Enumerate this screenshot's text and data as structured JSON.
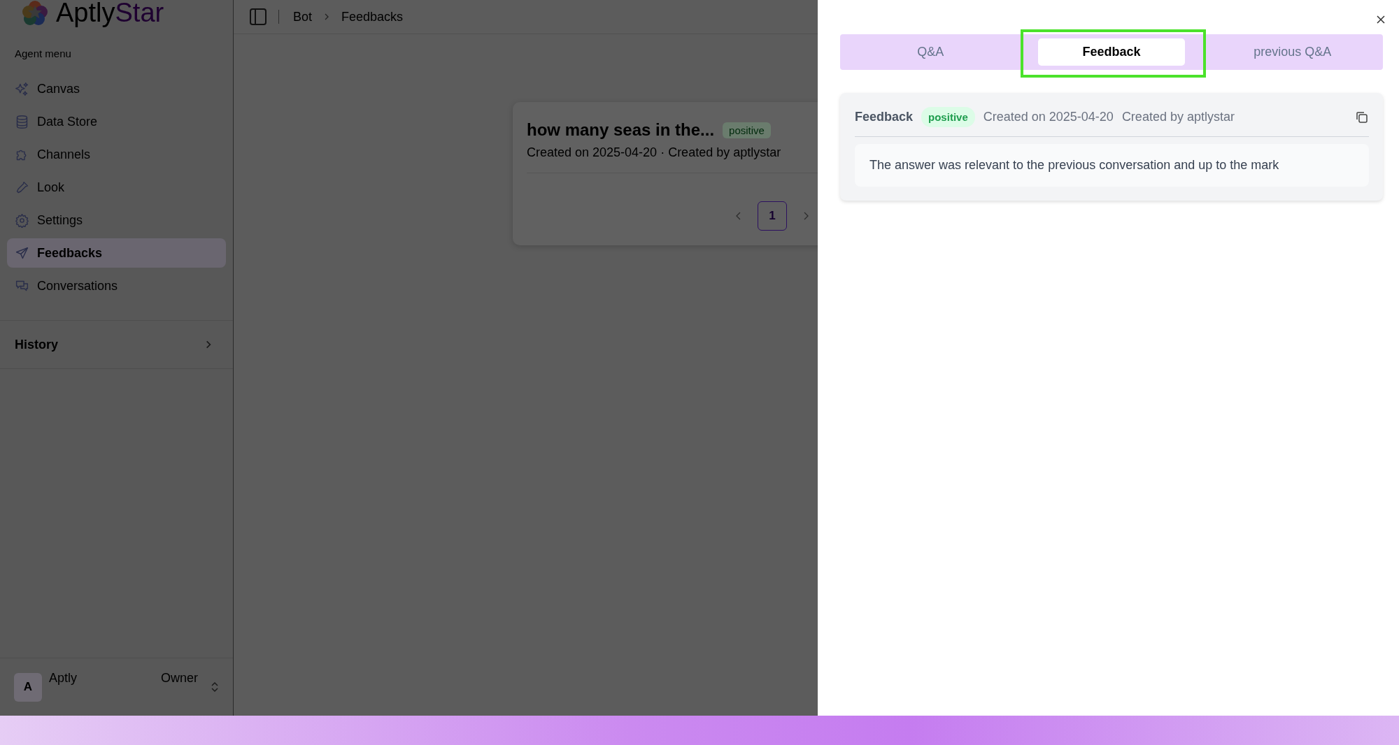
{
  "sidebar": {
    "logo": {
      "part_1": "Aptly",
      "part_2": "Star"
    },
    "section_label": "Agent menu",
    "items": [
      {
        "label": "Canvas",
        "kind": "sparkles",
        "selected": false
      },
      {
        "label": "Data Store",
        "kind": "database",
        "selected": false
      },
      {
        "label": "Channels",
        "kind": "puzzle",
        "selected": false
      },
      {
        "label": "Look",
        "kind": "dropper",
        "selected": false
      },
      {
        "label": "Settings",
        "kind": "gear",
        "selected": false
      },
      {
        "label": "Feedbacks",
        "kind": "send",
        "selected": true
      },
      {
        "label": "Conversations",
        "kind": "chat",
        "selected": false
      }
    ],
    "history": {
      "label": "History"
    },
    "user": {
      "avatar": "A",
      "name": "Aptly",
      "role": "Owner"
    }
  },
  "header": {
    "breadcrumb": [
      "Bot",
      "Feedbacks"
    ]
  },
  "feedback_list": {
    "items": [
      {
        "title": "how many seas in the...",
        "tag": "positive",
        "meta": "Created on 2025-04-20 · Created by aptlystar"
      }
    ],
    "pages": [
      {
        "label": "1",
        "selected": true
      }
    ]
  },
  "drawer": {
    "tabs": [
      {
        "label": "Q&A",
        "selected": false,
        "highlighted": false
      },
      {
        "label": "Feedback",
        "selected": true,
        "highlighted": true
      },
      {
        "label": "previous Q&A",
        "selected": false,
        "highlighted": false
      }
    ],
    "feedback": {
      "label": "Feedback",
      "tag": "positive",
      "created_on": "Created on 2025-04-20",
      "created_by": "Created by aptlystar",
      "text": "The answer was relevant to the previous conversation and up to the mark"
    }
  }
}
